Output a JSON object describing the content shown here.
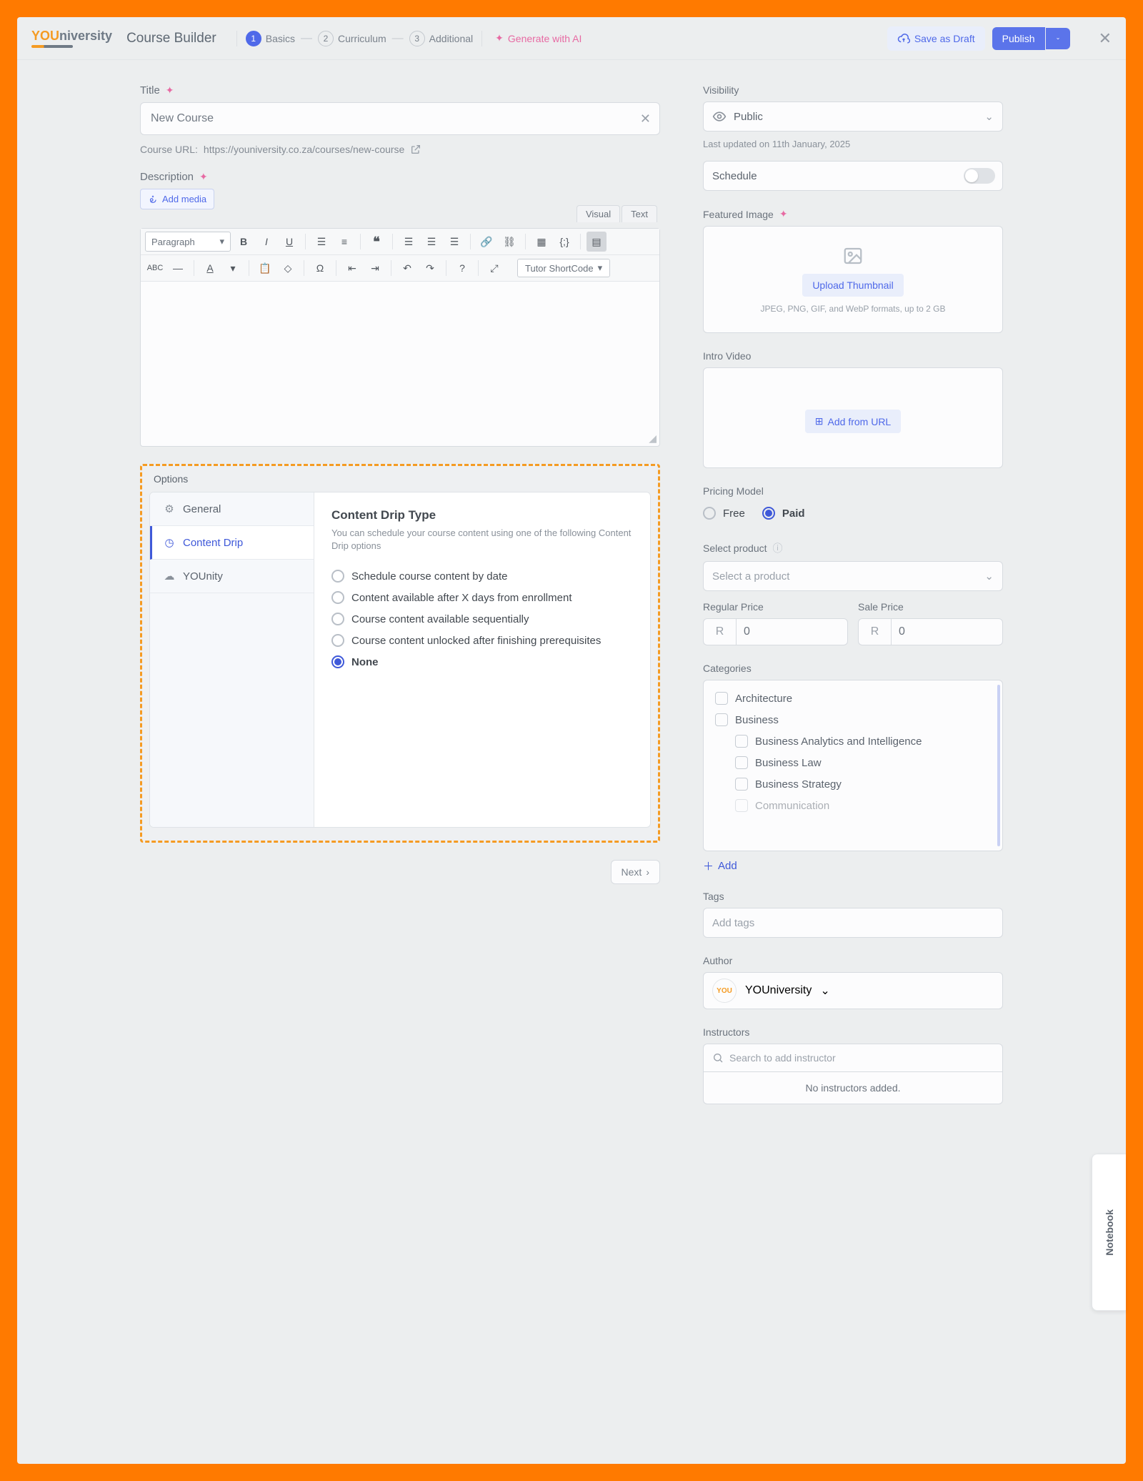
{
  "brand": {
    "you": "YOU",
    "rest": "niversity"
  },
  "header": {
    "title": "Course Builder",
    "steps": [
      {
        "num": "1",
        "label": "Basics",
        "active": true
      },
      {
        "num": "2",
        "label": "Curriculum",
        "active": false
      },
      {
        "num": "3",
        "label": "Additional",
        "active": false
      }
    ],
    "generate": "Generate with AI",
    "save_draft": "Save as Draft",
    "publish": "Publish"
  },
  "main": {
    "title_label": "Title",
    "title_value": "New Course",
    "url_pre": "Course URL: ",
    "url": "https://youniversity.co.za/courses/new-course",
    "desc_label": "Description",
    "add_media": "Add media",
    "ed_visual": "Visual",
    "ed_text": "Text",
    "paragraph": "Paragraph",
    "shortcode": "Tutor ShortCode",
    "next": "Next"
  },
  "options": {
    "title": "Options",
    "tabs": {
      "general": "General",
      "drip": "Content Drip",
      "younity": "YOUnity"
    },
    "drip": {
      "head": "Content Drip Type",
      "sub": "You can schedule your course content using one of the following Content Drip options",
      "items": [
        "Schedule course content by date",
        "Content available after X days from enrollment",
        "Course content available sequentially",
        "Course content unlocked after finishing prerequisites",
        "None"
      ],
      "selected": 4
    }
  },
  "side": {
    "visibility_label": "Visibility",
    "visibility_value": "Public",
    "updated": "Last updated on 11th January, 2025",
    "schedule": "Schedule",
    "featured": "Featured Image",
    "upload": "Upload Thumbnail",
    "upload_hint": "JPEG, PNG, GIF, and WebP formats, up to 2 GB",
    "intro": "Intro Video",
    "add_url": "Add from URL",
    "pricing": "Pricing Model",
    "free": "Free",
    "paid": "Paid",
    "sel_prod_label": "Select product",
    "sel_prod_ph": "Select a product",
    "reg": "Regular Price",
    "sale": "Sale Price",
    "cur": "R",
    "zero": "0",
    "cats": "Categories",
    "cat_items": [
      "Architecture",
      "Business",
      "Business Analytics and Intelligence",
      "Business Law",
      "Business Strategy",
      "Communication"
    ],
    "add": "Add",
    "tags": "Tags",
    "tags_ph": "Add tags",
    "author": "Author",
    "author_name": "YOUniversity",
    "instructors": "Instructors",
    "inst_ph": "Search to add instructor",
    "no_inst": "No instructors added."
  },
  "notebook": "Notebook"
}
